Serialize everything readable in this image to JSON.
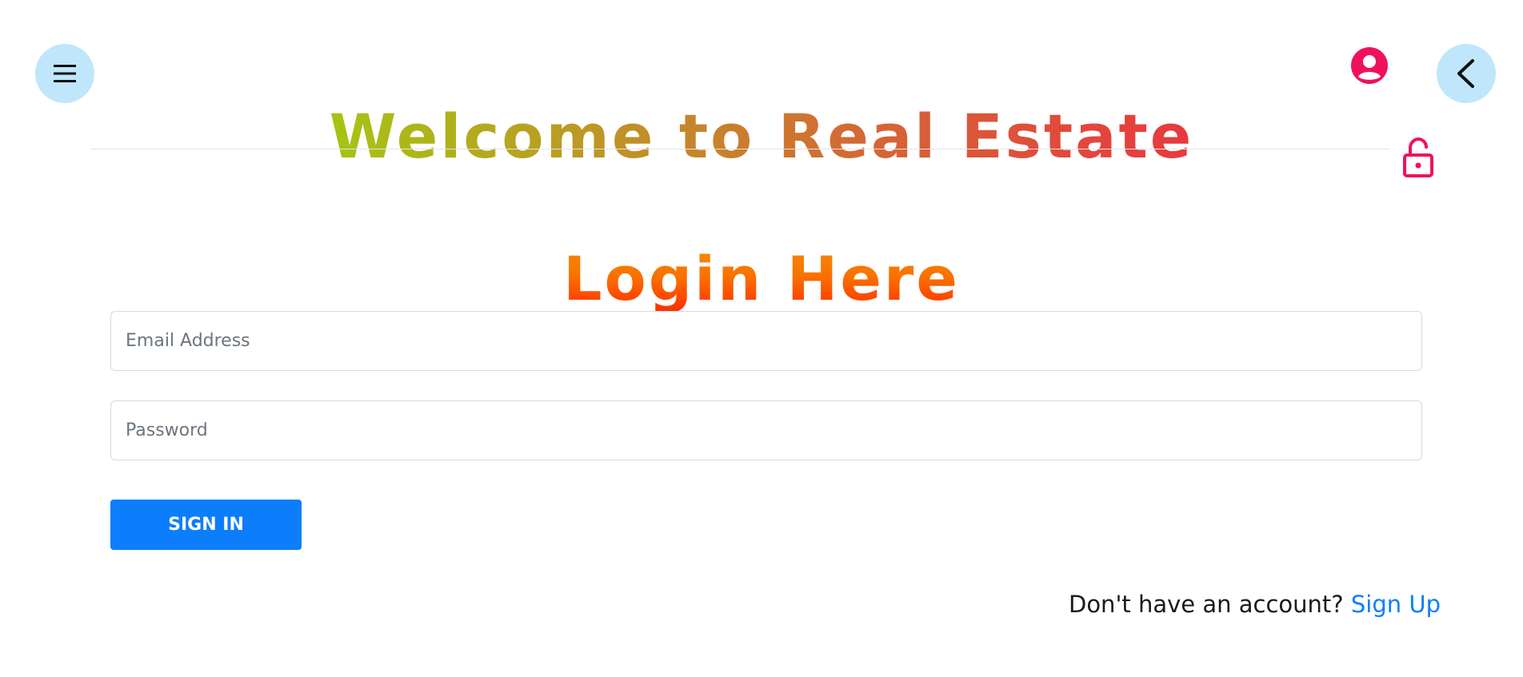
{
  "header": {
    "title": "Welcome to Real Estate",
    "menu_icon": "hamburger-menu-icon",
    "back_icon": "chevron-left-icon",
    "user_icon": "user-circle-icon",
    "lock_icon": "unlock-icon"
  },
  "login": {
    "title": "Login Here",
    "email_placeholder": "Email Address",
    "email_value": "",
    "password_placeholder": "Password",
    "password_value": "",
    "signin_label": "SIGN IN",
    "signup_prompt": "Don't have an account?",
    "signup_link": "Sign Up"
  },
  "colors": {
    "accent_blue": "#0d7efb",
    "icon_pink": "#f0115c",
    "circle_bg": "#bfe6fb",
    "title_gradient": [
      "#a6c414",
      "#c4892a",
      "#d95c38",
      "#e8383f"
    ],
    "login_gradient": [
      "#f48c06",
      "#f97300",
      "#ff2a00"
    ]
  }
}
